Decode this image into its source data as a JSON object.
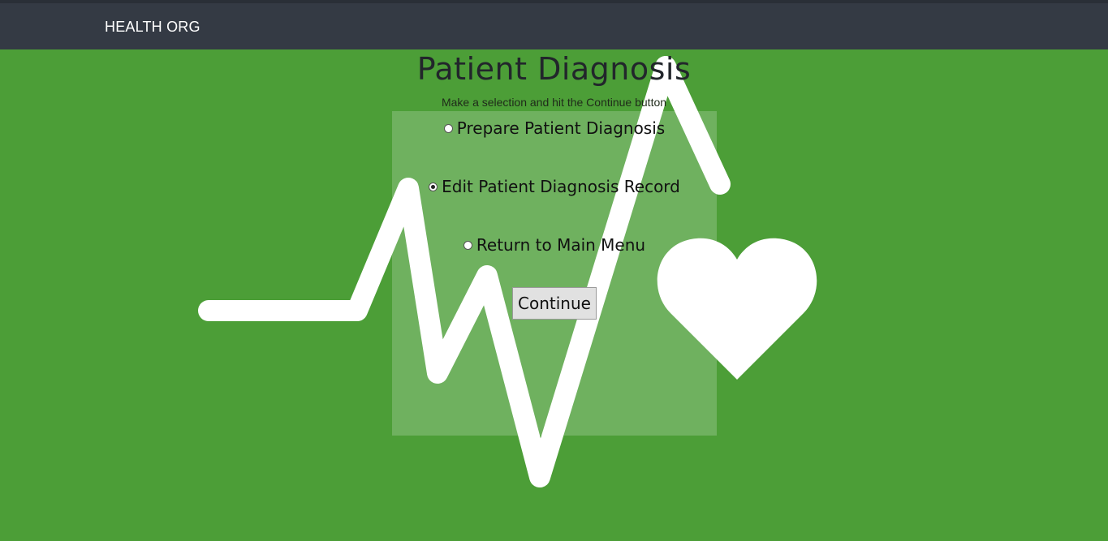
{
  "header": {
    "brand": "HEALTH ORG"
  },
  "main": {
    "title": "Patient Diagnosis",
    "subtitle": "Make a selection and hit the Continue button"
  },
  "options": [
    {
      "label": "Prepare Patient Diagnosis",
      "checked": false
    },
    {
      "label": "Edit Patient Diagnosis Record",
      "checked": true
    },
    {
      "label": "Return to Main Menu",
      "checked": false
    }
  ],
  "buttons": {
    "continue_label": "Continue"
  },
  "background": {
    "icons": [
      "heartbeat-line-icon",
      "heart-icon"
    ]
  },
  "colors": {
    "page_bg": "#4c9e37",
    "topbar_bg": "#343a44",
    "panel_overlay": "rgba(255,255,255,0.2)"
  }
}
